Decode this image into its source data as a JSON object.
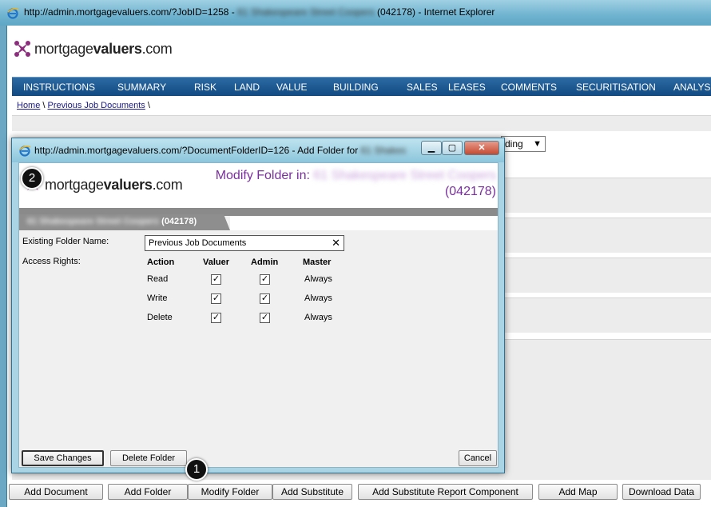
{
  "window": {
    "title_prefix": "http://admin.mortgagevaluers.com/?JobID=1258 -",
    "title_blur": "61 Shakespeare Street Coopers",
    "title_suffix": "(042178) - Internet Explorer"
  },
  "logo": {
    "brand_plain": "mortgage",
    "brand_bold": "valuers",
    "brand_tld": ".com"
  },
  "nav": {
    "items": [
      "INSTRUCTIONS",
      "SUMMARY",
      "RISK",
      "LAND",
      "VALUE",
      "BUILDING",
      "SALES",
      "LEASES",
      "COMMENTS",
      "SECURITISATION",
      "ANALYSIS"
    ]
  },
  "breadcrumb": {
    "home": "Home",
    "sep1": "\\",
    "current": "Previous Job Documents",
    "sep2": "\\"
  },
  "background": {
    "select_value": "ding",
    "buttons": [
      "Add Document",
      "Add Folder",
      "Modify Folder",
      "Add Substitute",
      "Add Substitute Report Component",
      "Add Map",
      "Download Data"
    ]
  },
  "popup": {
    "title_prefix": "http://admin.mortgagevaluers.com/?DocumentFolderID=126 - Add Folder for",
    "title_blur": "61 Shakes",
    "heading_prefix": "Modify Folder in:",
    "heading_blur": "61 Shakespeare Street Coopers",
    "heading_job": "(042178)",
    "tab_blur": "61 Shakespeare Street Coopers",
    "tab_job": "(042178)",
    "folder_label": "Existing Folder Name:",
    "folder_value": "Previous Job Documents",
    "access_label": "Access Rights:",
    "columns": [
      "Action",
      "Valuer",
      "Admin",
      "Master"
    ],
    "rows": [
      {
        "action": "Read",
        "valuer": true,
        "admin": true,
        "master": "Always"
      },
      {
        "action": "Write",
        "valuer": true,
        "admin": true,
        "master": "Always"
      },
      {
        "action": "Delete",
        "valuer": true,
        "admin": true,
        "master": "Always"
      }
    ],
    "save_label": "Save Changes",
    "delete_label": "Delete Folder",
    "cancel_label": "Cancel"
  },
  "badges": {
    "step1": "1",
    "step2": "2"
  },
  "icons": {
    "ie": "ie-icon",
    "logo": "mortgagevaluers-logo-icon",
    "clear": "clear-x-icon",
    "check": "checkmark-icon"
  },
  "colors": {
    "nav_bg": "#1b5590",
    "heading": "#7a2f9e",
    "link": "#1a1a8a"
  }
}
